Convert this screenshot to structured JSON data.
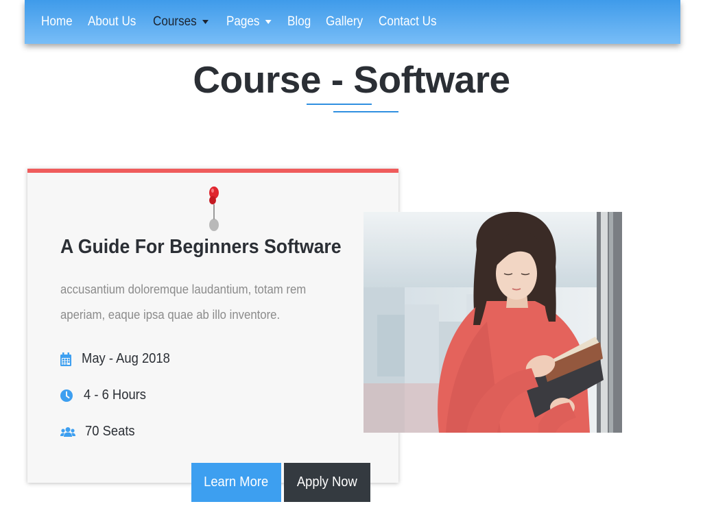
{
  "nav": {
    "items": [
      {
        "label": "Home",
        "dropdown": false,
        "active": false
      },
      {
        "label": "About Us",
        "dropdown": false,
        "active": false
      },
      {
        "label": "Courses",
        "dropdown": true,
        "active": true
      },
      {
        "label": "Pages",
        "dropdown": true,
        "active": false
      },
      {
        "label": "Blog",
        "dropdown": false,
        "active": false
      },
      {
        "label": "Gallery",
        "dropdown": false,
        "active": false
      },
      {
        "label": "Contact Us",
        "dropdown": false,
        "active": false
      }
    ]
  },
  "page": {
    "title_light": "Course - ",
    "title_bold": "Software"
  },
  "course": {
    "title": "A Guide For Beginners Software",
    "description": "accusantium doloremque laudantium, totam rem aperiam, eaque ipsa quae ab illo inventore.",
    "date": "May - Aug 2018",
    "hours": "4 - 6 Hours",
    "seats": "70 Seats",
    "learn_more_label": "Learn More",
    "apply_now_label": "Apply Now",
    "icons": {
      "date": "calendar-icon",
      "hours": "clock-icon",
      "seats": "users-icon",
      "pin": "pushpin-icon"
    }
  },
  "colors": {
    "nav_top": "#3f9bea",
    "nav_bottom": "#78bdf7",
    "accent_blue": "#3d9ff0",
    "card_top_border": "#ef5c5c",
    "apply_button": "#343a40"
  }
}
